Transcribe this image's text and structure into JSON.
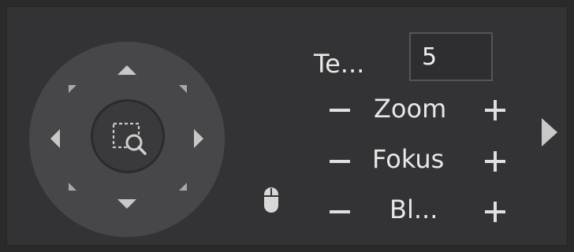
{
  "ptz": {
    "speed_label": "Te...",
    "speed_value": "5",
    "rows": [
      {
        "label": "Zoom"
      },
      {
        "label": "Fokus"
      },
      {
        "label": "Bl..."
      }
    ]
  },
  "icons": {
    "up": "arrow-up-icon",
    "down": "arrow-down-icon",
    "left": "arrow-left-icon",
    "right": "arrow-right-icon",
    "center": "zoom-region-icon",
    "mouse": "mouse-icon",
    "expand": "expand-arrow-icon"
  },
  "colors": {
    "panel_bg": "#333335",
    "pad_bg": "#474749",
    "arrow": "#c8c8c8",
    "text": "#e8e8e8"
  }
}
